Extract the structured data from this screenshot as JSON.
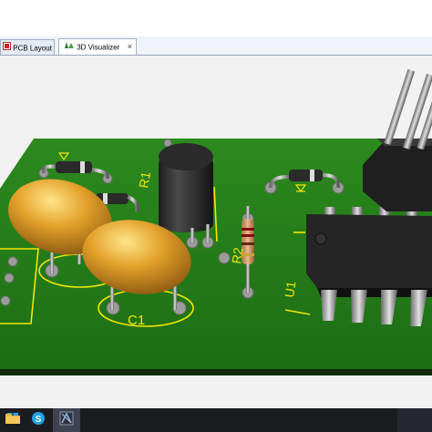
{
  "tabs": [
    {
      "label": "PCB Layout",
      "icon": "pcb-layout-icon",
      "active": false
    },
    {
      "label": "3D Visualizer",
      "icon": "3d-visualizer-icon",
      "active": true,
      "close": "×"
    }
  ],
  "board": {
    "silkscreen_labels": [
      "R1",
      "R2",
      "C1",
      "U1"
    ]
  },
  "colors": {
    "board_green": "#1f7a16",
    "silkscreen_yellow": "#f2e600",
    "capacitor_gold": "#d89a1c",
    "ic_black": "#222222",
    "pad_grey": "#9c9c9c"
  },
  "taskbar": {
    "items": [
      "start-icon",
      "folder-icon",
      "skype-icon",
      "app-icon"
    ]
  }
}
